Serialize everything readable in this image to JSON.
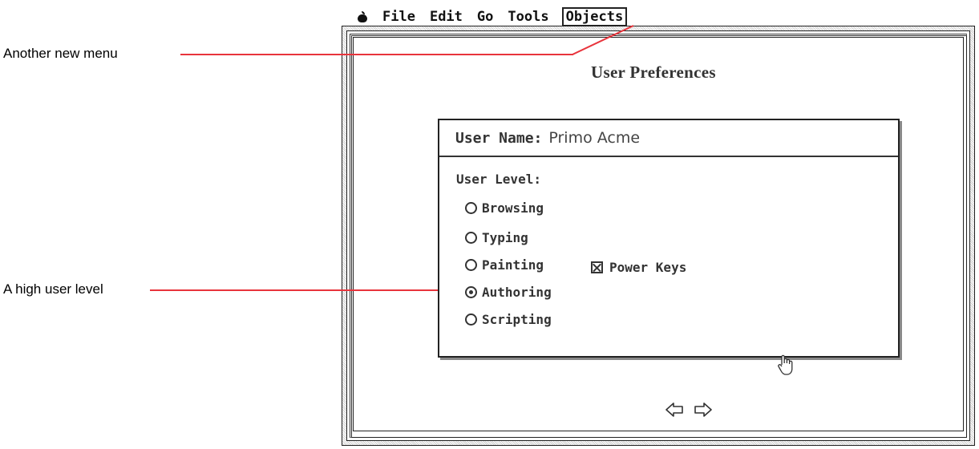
{
  "menubar": {
    "items": [
      "File",
      "Edit",
      "Go",
      "Tools",
      "Objects"
    ]
  },
  "callouts": {
    "menu": "Another new menu",
    "level": "A high user level"
  },
  "dialog": {
    "title": "User Preferences",
    "user_name_label": "User Name:",
    "user_name_value": "Primo Acme",
    "user_level_label": "User Level:",
    "levels": [
      {
        "label": "Browsing",
        "selected": false
      },
      {
        "label": "Typing",
        "selected": false
      },
      {
        "label": "Painting",
        "selected": false
      },
      {
        "label": "Authoring",
        "selected": true
      },
      {
        "label": "Scripting",
        "selected": false
      }
    ],
    "power_keys_label": "Power Keys",
    "power_keys_checked": true
  }
}
